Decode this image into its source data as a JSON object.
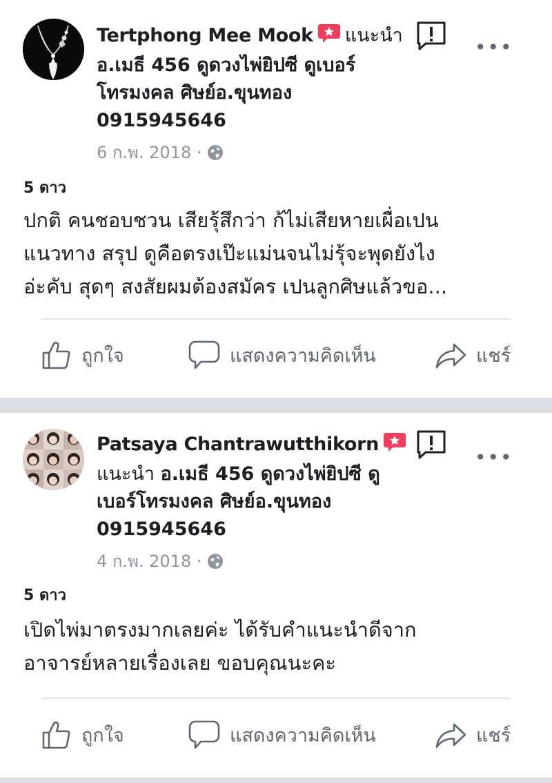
{
  "posts": [
    {
      "author": "Tertphong Mee Mook",
      "recommend_word": "แนะนำ",
      "text_lines": [
        "อ.เมธี 456 ดูดวงไพ่ยิปซี ดูเบอร์",
        "โทรมงคล ศิษย์อ.ขุนทอง",
        "0915945646"
      ],
      "date": "6 ก.พ. 2018 ·",
      "rating": "5 ดาว",
      "review_lines": [
        "ปกติ คนชอบชวน  เสียรุ้สึกว่า ก้ไม่เสียหายเผื่อเปน",
        "แนวทาง  สรุป ดูคือตรงเป๊ะแม่นจนไม่รุ้จะพุดยังไง",
        "อ่ะคับ สุดๆ  สงสัยผมต้องสมัคร เปนลูกศิษแล้วขอ..."
      ],
      "actions": {
        "like": "ถูกใจ",
        "comment": "แสดงความคิดเห็น",
        "share": "แชร์"
      }
    },
    {
      "author": "Patsaya Chantrawutthikorn",
      "recommend_word": "แนะนำ",
      "text_lines": [
        "อ.เมธี 456 ดูดวงไพ่ยิปซี ดู",
        "เบอร์โทรมงคล ศิษย์อ.ขุนทอง",
        "0915945646"
      ],
      "date": "4 ก.พ. 2018 ·",
      "rating": "5 ดาว",
      "review_lines": [
        "เปิดไพ่มาตรงมากเลยค่ะ ได้รับคำแนะนำดีจาก",
        "อาจารย์หลายเรื่องเลย ขอบคุณนะคะ"
      ],
      "actions": {
        "like": "ถูกใจ",
        "comment": "แสดงความคิดเห็น",
        "share": "แชร์"
      }
    }
  ],
  "colors": {
    "recommend_red": "#f03e5f",
    "meta_gray": "#8d949e",
    "action_gray": "#606770",
    "separator": "#dadde1"
  },
  "icons": [
    "more-icon",
    "report-icon",
    "globe-icon",
    "like-icon",
    "comment-icon",
    "share-icon",
    "recommend-star-icon"
  ]
}
